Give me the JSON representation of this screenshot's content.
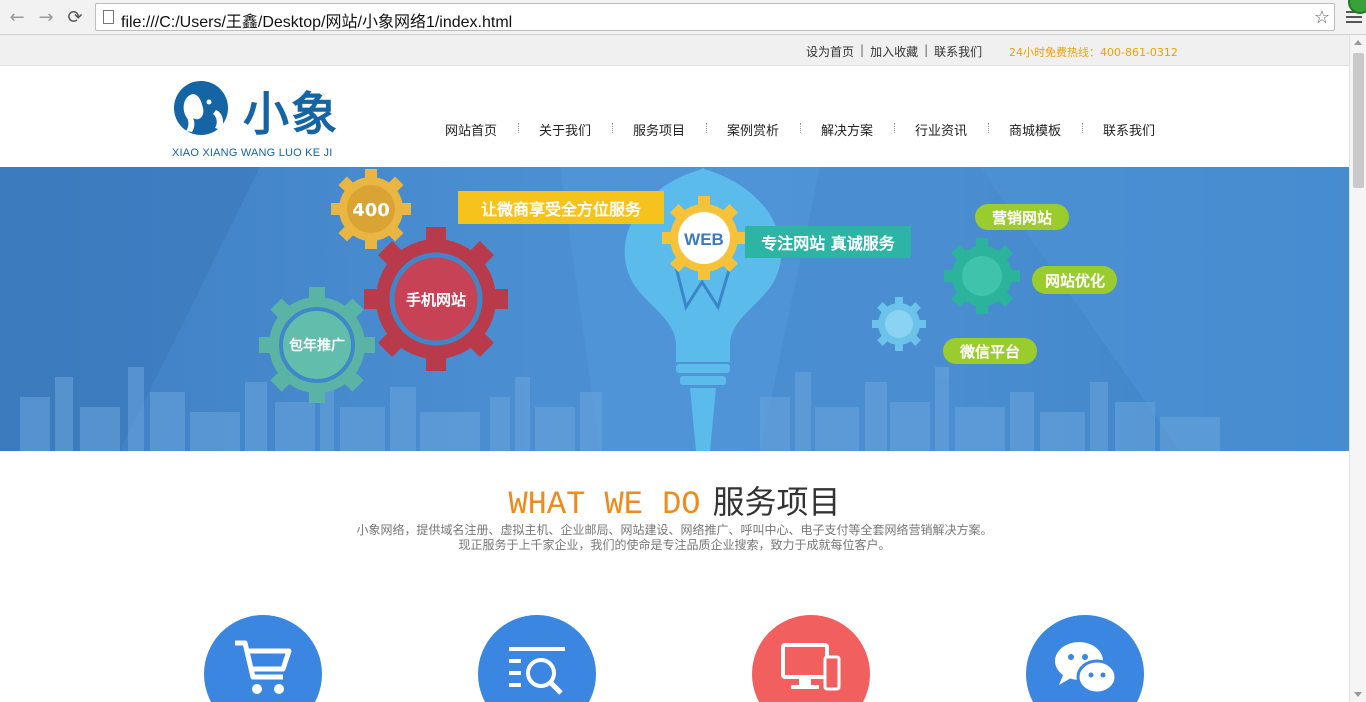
{
  "browser": {
    "url": "file:///C:/Users/王鑫/Desktop/网站/小象网络1/index.html",
    "back_icon": "arrow-left-icon",
    "forward_icon": "arrow-right-icon",
    "reload_icon": "reload-icon",
    "star_icon": "star-icon"
  },
  "topbar": {
    "links": [
      "设为首页",
      "加入收藏",
      "联系我们"
    ],
    "hotline": "24小时免费热线：400-861-0312",
    "hotline_color": "#f0a000"
  },
  "logo": {
    "brand": "小象",
    "brand_en": "XIAO XIANG WANG LUO KE JI",
    "color": "#1564a4"
  },
  "nav": [
    "网站首页",
    "关于我们",
    "服务项目",
    "案例赏析",
    "解决方案",
    "行业资讯",
    "商城模板",
    "联系我们"
  ],
  "banner": {
    "gear_400": "400",
    "gear_mobile": "手机网站",
    "gear_promo": "包年推广",
    "slogan_top": "让微商享受全方位服务",
    "web": "WEB",
    "slogan_mid": "专注网站 真诚服务",
    "tag_marketing": "营销网站",
    "tag_seo": "网站优化",
    "tag_wechat": "微信平台"
  },
  "services": {
    "title_en": "WHAT WE DO",
    "title_cn": "服务项目",
    "desc_line1": "小象网络，提供域名注册、虚拟主机、企业邮局、网站建设、网络推广、呼叫中心、电子支付等全套网络营销解决方案。",
    "desc_line2": "现正服务于上千家企业，我们的使命是专注品质企业搜索，致力于成就每位客户。",
    "icons": [
      {
        "name": "cart-icon",
        "color": "#3a86e0"
      },
      {
        "name": "search-document-icon",
        "color": "#3a86e0"
      },
      {
        "name": "devices-icon",
        "color": "#f25f5f"
      },
      {
        "name": "chat-icon",
        "color": "#3a86e0"
      }
    ]
  }
}
